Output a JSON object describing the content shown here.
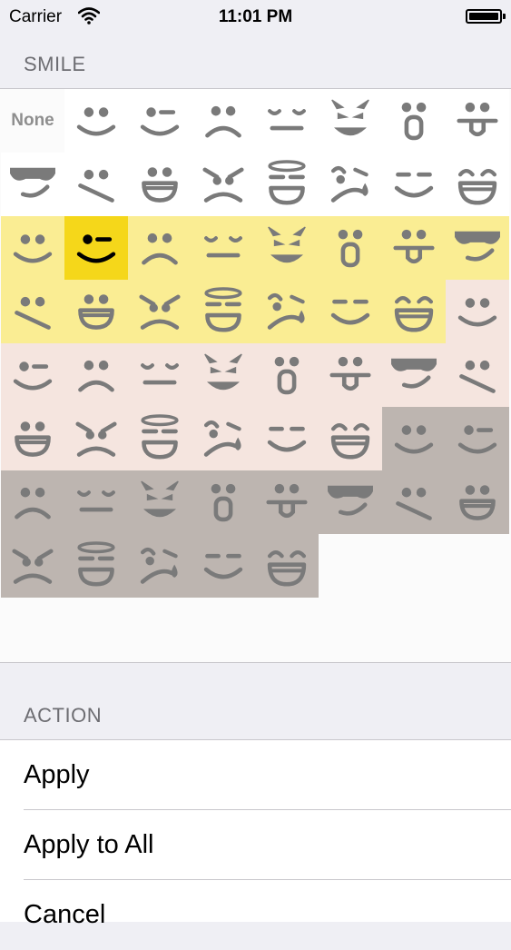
{
  "status_bar": {
    "carrier": "Carrier",
    "time": "11:01 PM",
    "battery_level": 0.9
  },
  "section_smile": {
    "header": "SMILE"
  },
  "section_action": {
    "header": "ACTION"
  },
  "none_label": "None",
  "colors": {
    "grid_bg": "#fbfbfb",
    "white": "#ffffff",
    "yellow": "#faed93",
    "peach": "#f5e5df",
    "taupe": "#bdb5b0",
    "selected": "#f5d71a",
    "icon": "#7a7a7a",
    "icon_selected": "#000000"
  },
  "palette_order": [
    "white",
    "yellow",
    "peach",
    "taupe"
  ],
  "icon_sequence": [
    "smile",
    "wink",
    "sad",
    "sleepy",
    "devil",
    "surprised",
    "tongue",
    "cool",
    "meh",
    "grin",
    "angry",
    "angel",
    "crying",
    "content",
    "laugh"
  ],
  "selected": {
    "color": "yellow",
    "icon": "wink"
  },
  "actions": [
    {
      "label": "Apply"
    },
    {
      "label": "Apply to All"
    },
    {
      "label": "Cancel"
    }
  ]
}
